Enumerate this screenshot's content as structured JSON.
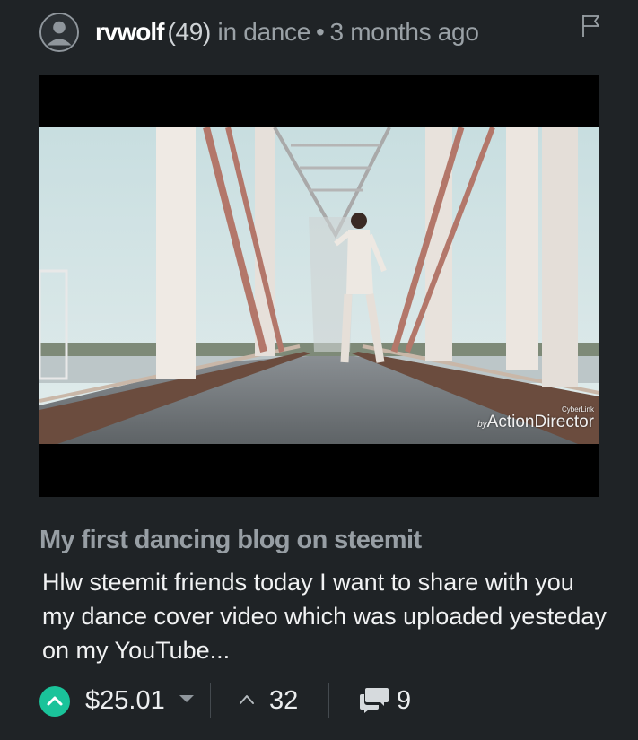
{
  "post": {
    "author": "rvwolf",
    "reputation": "(49)",
    "category_prefix": "in dance",
    "separator": "•",
    "time_ago": "3 months ago",
    "thumbnail_watermark": {
      "small": "CyberLink",
      "by": "by",
      "main": "ActionDirector"
    },
    "title": "My first dancing blog on steemit",
    "excerpt": "Hlw steemit friends today I want to share with you my dance cover video which was uploaded yesteday on my YouTube..."
  },
  "footer": {
    "payout": "$25.01",
    "votes": "32",
    "comments": "9"
  },
  "icons": {
    "avatar": "user-avatar-icon",
    "flag": "flag-icon",
    "upvote": "upvote-icon",
    "dropdown": "caret-down-icon",
    "votes": "chevron-up-icon",
    "comments": "comments-icon"
  },
  "colors": {
    "background": "#1f2326",
    "accent": "#1ac39a",
    "title": "#979ea4",
    "text": "#f1f2f3",
    "muted": "#9aa1a6"
  }
}
